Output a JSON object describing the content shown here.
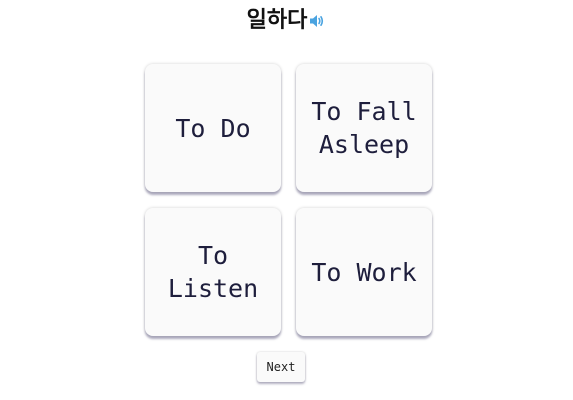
{
  "question": {
    "word": "일하다",
    "audio_icon": "speaker-volume-icon"
  },
  "options": [
    {
      "label": "To Do"
    },
    {
      "label": "To Fall Asleep"
    },
    {
      "label": "To Listen"
    },
    {
      "label": "To Work"
    }
  ],
  "controls": {
    "next_label": "Next"
  },
  "colors": {
    "speaker": "#4aa3e0",
    "card_text": "#1e1e3c",
    "card_bg": "#fafafa"
  }
}
